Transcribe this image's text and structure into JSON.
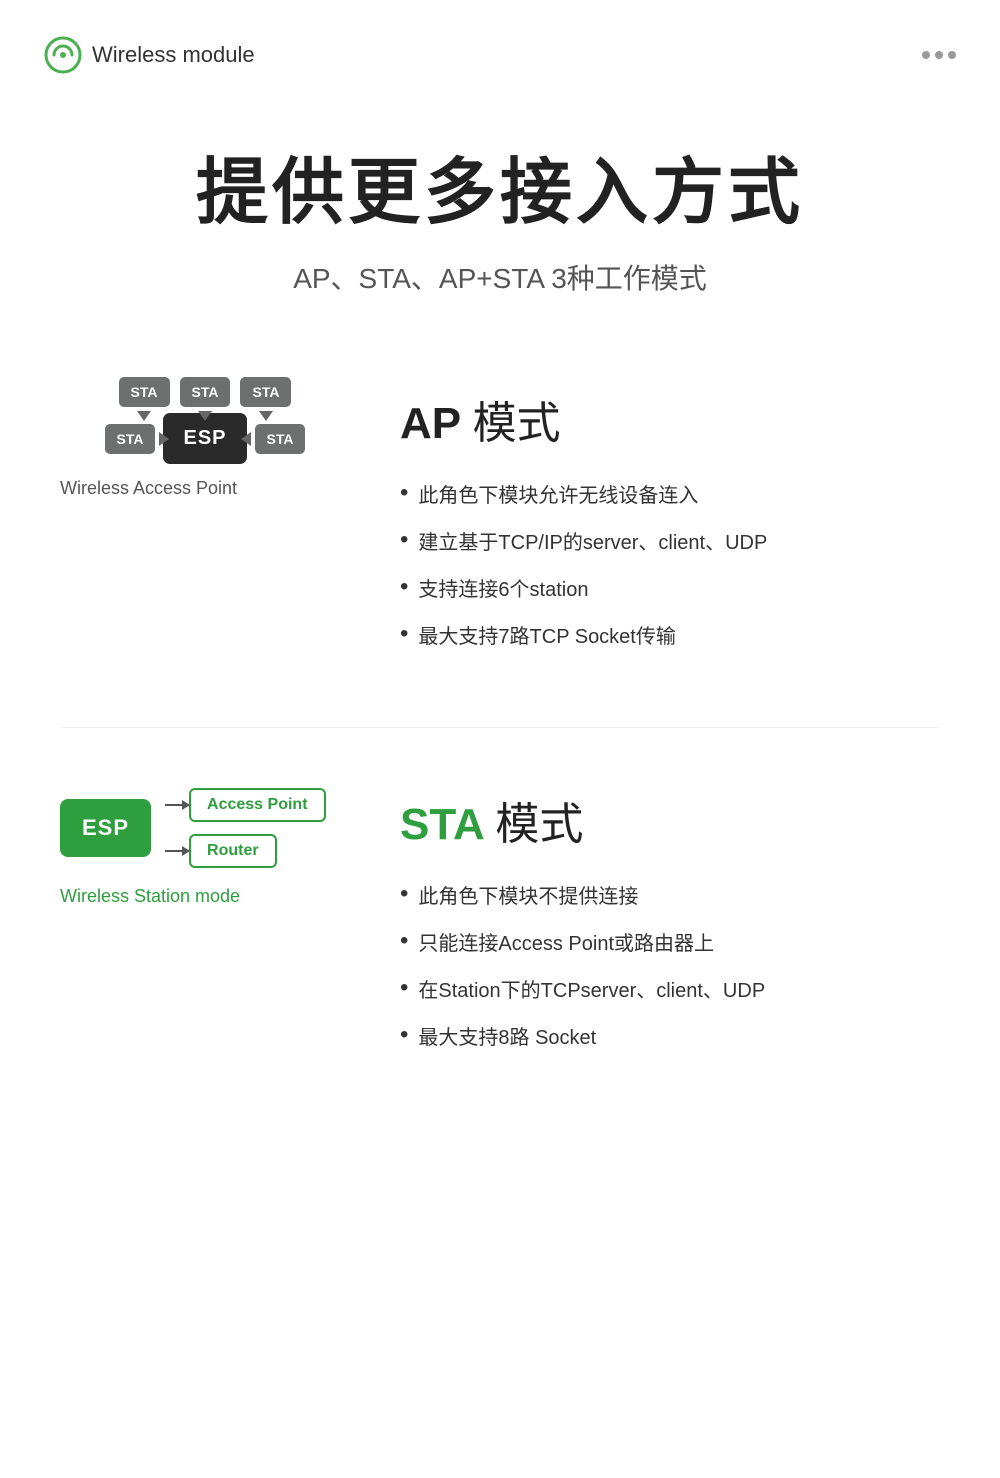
{
  "header": {
    "logo_alt": "Wireless module logo",
    "title": "Wireless module",
    "dots_label": "more options"
  },
  "hero": {
    "title": "提供更多接入方式",
    "subtitle": "AP、STA、AP+STA 3种工作模式"
  },
  "ap_section": {
    "diagram_caption": "Wireless Access Point",
    "heading_prefix": "AP",
    "heading_suffix": "模式",
    "bullets": [
      "此角色下模块允许无线设备连入",
      "建立基于TCP/IP的server、client、UDP",
      "支持连接6个station",
      "最大支持7路TCP Socket传输"
    ],
    "nodes": {
      "top": [
        "STA",
        "STA",
        "STA"
      ],
      "mid_left": "STA",
      "center": "ESP",
      "mid_right": "STA"
    }
  },
  "sta_section": {
    "esp_label": "ESP",
    "access_point_label": "Access Point",
    "router_label": "Router",
    "diagram_caption": "Wireless Station mode",
    "heading_prefix": "STA",
    "heading_suffix": "模式",
    "bullets": [
      "此角色下模块不提供连接",
      "只能连接Access Point或路由器上",
      "在Station下的TCPserver、client、UDP",
      "最大支持8路 Socket"
    ]
  }
}
